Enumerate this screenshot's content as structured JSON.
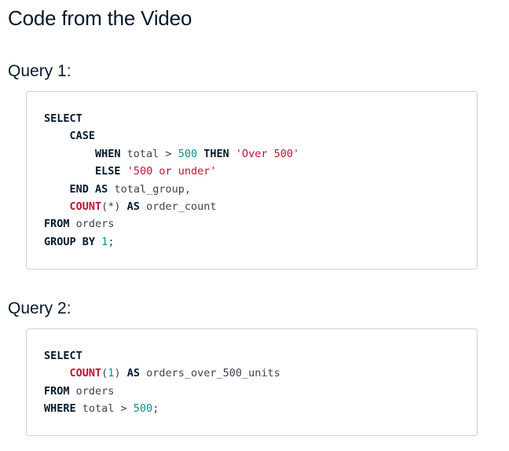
{
  "page": {
    "title": "Code from the Video"
  },
  "query1": {
    "heading": "Query 1:",
    "lines": [
      [
        {
          "t": "kw",
          "v": "SELECT"
        }
      ],
      [
        {
          "t": "txt",
          "v": "    "
        },
        {
          "t": "kw",
          "v": "CASE"
        }
      ],
      [
        {
          "t": "txt",
          "v": "        "
        },
        {
          "t": "kw",
          "v": "WHEN"
        },
        {
          "t": "txt",
          "v": " total > "
        },
        {
          "t": "num",
          "v": "500"
        },
        {
          "t": "txt",
          "v": " "
        },
        {
          "t": "kw",
          "v": "THEN"
        },
        {
          "t": "txt",
          "v": " "
        },
        {
          "t": "str",
          "v": "'Over 500'"
        }
      ],
      [
        {
          "t": "txt",
          "v": "        "
        },
        {
          "t": "kw",
          "v": "ELSE"
        },
        {
          "t": "txt",
          "v": " "
        },
        {
          "t": "str",
          "v": "'500 or under'"
        }
      ],
      [
        {
          "t": "txt",
          "v": "    "
        },
        {
          "t": "kw",
          "v": "END"
        },
        {
          "t": "txt",
          "v": " "
        },
        {
          "t": "kw",
          "v": "AS"
        },
        {
          "t": "txt",
          "v": " total_group,"
        }
      ],
      [
        {
          "t": "txt",
          "v": "    "
        },
        {
          "t": "fn",
          "v": "COUNT"
        },
        {
          "t": "txt",
          "v": "(*) "
        },
        {
          "t": "kw",
          "v": "AS"
        },
        {
          "t": "txt",
          "v": " order_count"
        }
      ],
      [
        {
          "t": "kw",
          "v": "FROM"
        },
        {
          "t": "txt",
          "v": " orders"
        }
      ],
      [
        {
          "t": "kw",
          "v": "GROUP BY"
        },
        {
          "t": "txt",
          "v": " "
        },
        {
          "t": "num",
          "v": "1"
        },
        {
          "t": "txt",
          "v": ";"
        }
      ]
    ]
  },
  "query2": {
    "heading": "Query 2:",
    "lines": [
      [
        {
          "t": "kw",
          "v": "SELECT"
        }
      ],
      [
        {
          "t": "txt",
          "v": "    "
        },
        {
          "t": "fn",
          "v": "COUNT"
        },
        {
          "t": "txt",
          "v": "("
        },
        {
          "t": "num",
          "v": "1"
        },
        {
          "t": "txt",
          "v": ") "
        },
        {
          "t": "kw",
          "v": "AS"
        },
        {
          "t": "txt",
          "v": " orders_over_500_units"
        }
      ],
      [
        {
          "t": "kw",
          "v": "FROM"
        },
        {
          "t": "txt",
          "v": " orders"
        }
      ],
      [
        {
          "t": "kw",
          "v": "WHERE"
        },
        {
          "t": "txt",
          "v": " total > "
        },
        {
          "t": "num",
          "v": "500"
        },
        {
          "t": "txt",
          "v": ";"
        }
      ]
    ]
  }
}
